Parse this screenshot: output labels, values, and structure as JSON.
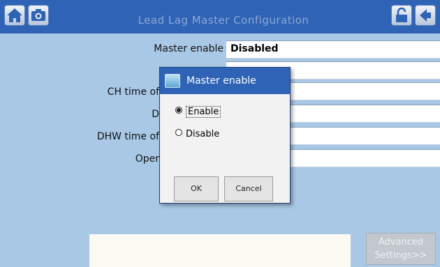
{
  "header": {
    "title": "Lead Lag Master Configuration"
  },
  "form": {
    "rows": [
      {
        "label": "Master enable",
        "value": "Disabled"
      },
      {
        "label": "",
        "value": ""
      },
      {
        "label": "CH time of",
        "value": ""
      },
      {
        "label": "D",
        "value": ""
      },
      {
        "label": "DHW time of",
        "value": ""
      },
      {
        "label": "Oper",
        "value": ""
      }
    ]
  },
  "dialog": {
    "title": "Master enable",
    "options": [
      {
        "label": "Enable",
        "selected": true
      },
      {
        "label": "Disable",
        "selected": false
      }
    ],
    "ok_label": "OK",
    "cancel_label": "Cancel"
  },
  "advanced_button": {
    "line1": "Advanced",
    "line2": "Settings>>"
  },
  "colors": {
    "header": "#2e63b5",
    "background": "#a9c8e6",
    "dialog_titlebar": "#2e63b5"
  },
  "icons": [
    "home-icon",
    "camera-icon",
    "lock-icon",
    "back-arrow-icon",
    "dialog-app-icon"
  ]
}
